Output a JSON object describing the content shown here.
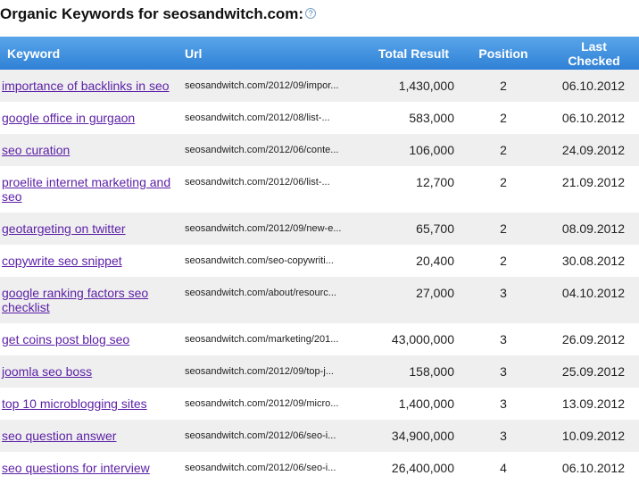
{
  "title": "Organic Keywords for seosandwitch.com:",
  "help_icon": "?",
  "columns": {
    "keyword": "Keyword",
    "url": "Url",
    "total": "Total Result",
    "position": "Position",
    "last_checked": "Last Checked"
  },
  "rows": [
    {
      "keyword": "importance of backlinks in seo",
      "url": "seosandwitch.com/2012/09/impor...",
      "total": "1,430,000",
      "position": "2",
      "date": "06.10.2012"
    },
    {
      "keyword": "google office in gurgaon",
      "url": "seosandwitch.com/2012/08/list-...",
      "total": "583,000",
      "position": "2",
      "date": "06.10.2012"
    },
    {
      "keyword": "seo curation",
      "url": "seosandwitch.com/2012/06/conte...",
      "total": "106,000",
      "position": "2",
      "date": "24.09.2012"
    },
    {
      "keyword": "proelite internet marketing and seo",
      "url": "seosandwitch.com/2012/06/list-...",
      "total": "12,700",
      "position": "2",
      "date": "21.09.2012"
    },
    {
      "keyword": "geotargeting on twitter",
      "url": "seosandwitch.com/2012/09/new-e...",
      "total": "65,700",
      "position": "2",
      "date": "08.09.2012"
    },
    {
      "keyword": "copywrite seo snippet",
      "url": "seosandwitch.com/seo-copywriti...",
      "total": "20,400",
      "position": "2",
      "date": "30.08.2012"
    },
    {
      "keyword": "google ranking factors seo checklist",
      "url": "seosandwitch.com/about/resourc...",
      "total": "27,000",
      "position": "3",
      "date": "04.10.2012"
    },
    {
      "keyword": "get coins post blog seo",
      "url": "seosandwitch.com/marketing/201...",
      "total": "43,000,000",
      "position": "3",
      "date": "26.09.2012"
    },
    {
      "keyword": "joomla seo boss",
      "url": "seosandwitch.com/2012/09/top-j...",
      "total": "158,000",
      "position": "3",
      "date": "25.09.2012"
    },
    {
      "keyword": "top 10 microblogging sites",
      "url": "seosandwitch.com/2012/09/micro...",
      "total": "1,400,000",
      "position": "3",
      "date": "13.09.2012"
    },
    {
      "keyword": "seo question answer",
      "url": "seosandwitch.com/2012/06/seo-i...",
      "total": "34,900,000",
      "position": "3",
      "date": "10.09.2012"
    },
    {
      "keyword": "seo questions for interview",
      "url": "seosandwitch.com/2012/06/seo-i...",
      "total": "26,400,000",
      "position": "4",
      "date": "06.10.2012"
    }
  ]
}
